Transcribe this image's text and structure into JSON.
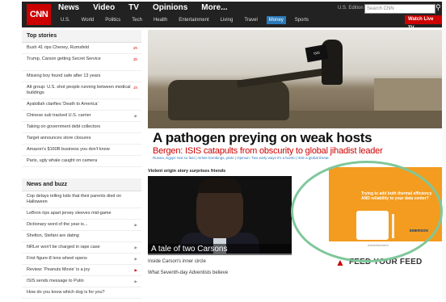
{
  "header": {
    "logo_text": "CNN",
    "primary_nav": [
      "News",
      "Video",
      "TV",
      "Opinions",
      "More..."
    ],
    "secondary_nav": [
      "U.S.",
      "World",
      "Politics",
      "Tech",
      "Health",
      "Entertainment",
      "Living",
      "Travel",
      "Money",
      "Sports"
    ],
    "active_secondary": "Money",
    "edition": "U.S. Edition",
    "search_placeholder": "Search CNN",
    "watch_live": "Watch Live TV"
  },
  "top_stories": {
    "title": "Top stories",
    "items": [
      {
        "text": "Bush 41 rips Cheney, Rumsfeld",
        "tag": "2h",
        "tag_style": "red"
      },
      {
        "text": "Trump, Carson getting Secret Service",
        "tag": "3h",
        "tag_style": "red"
      },
      {
        "text": "Missing boy found safe after 13 years",
        "tag": "",
        "tag_style": ""
      },
      {
        "text": "Alt group: U.S. shot people running between medical buildings",
        "tag": "1h",
        "tag_style": "red"
      },
      {
        "text": "Ayatollah clarifies 'Death to America'",
        "tag": "",
        "tag_style": ""
      },
      {
        "text": "Chinese sub tracked U.S. carrier",
        "tag": "",
        "tag_style": "gray"
      },
      {
        "text": "Taking on government debt collectors",
        "tag": "",
        "tag_style": ""
      },
      {
        "text": "Target announces store closures",
        "tag": "",
        "tag_style": ""
      },
      {
        "text": "Amazon's $160B business you don't know",
        "tag": "",
        "tag_style": ""
      },
      {
        "text": "Paris, ugly whale caught on camera",
        "tag": "",
        "tag_style": ""
      }
    ]
  },
  "news_and_buzz": {
    "title": "News and buzz",
    "items": [
      {
        "text": "Cop delays telling kids that their parents died on Halloween",
        "tag": ""
      },
      {
        "text": "LeBron rips apart jersey sleeves mid-game",
        "tag": ""
      },
      {
        "text": "Dictionary word of the year is...",
        "tag": ""
      },
      {
        "text": "Shelton, Stefani are dating",
        "tag": ""
      },
      {
        "text": "NRLer won't be charged in rape case",
        "tag": ""
      },
      {
        "text": "First figure-8 lens wheel opens",
        "tag": ""
      },
      {
        "text": "Review: 'Peanuts Movie' is a joy",
        "tag": ""
      },
      {
        "text": "ISIS sends message to Putin",
        "tag": ""
      },
      {
        "text": "How do you know which dog is for you?",
        "tag": ""
      }
    ]
  },
  "hero": {
    "flag_text": "ISIS",
    "headline": "A pathogen preying on weak hosts",
    "subhead": "Bergen: ISIS catapults from obscurity to global jihadist leader",
    "kicker": "Russia, Egypt: Not so fast | Airline bombings, plots | Opinion: Two early ways it's a bomb | ISIS a global threat"
  },
  "middle": {
    "section_title": "Violent origin story surprises friends",
    "caption": "A tale of two Carsons",
    "links": [
      "Inside Carson's inner circle",
      "What Seventh-day Adventists believe"
    ]
  },
  "ad": {
    "text": "Trying to add both thermal efficiency AND reliability to your data center?",
    "brand": "EMERSON",
    "label": "Advertisement",
    "feed_text": "FEED YOUR FEED"
  },
  "colors": {
    "brand_red": "#cc0000",
    "header_bg": "#222222",
    "active_tab": "#2a7ab9",
    "ad_orange": "#f39c1f",
    "annotation_green": "#7fc79a"
  }
}
